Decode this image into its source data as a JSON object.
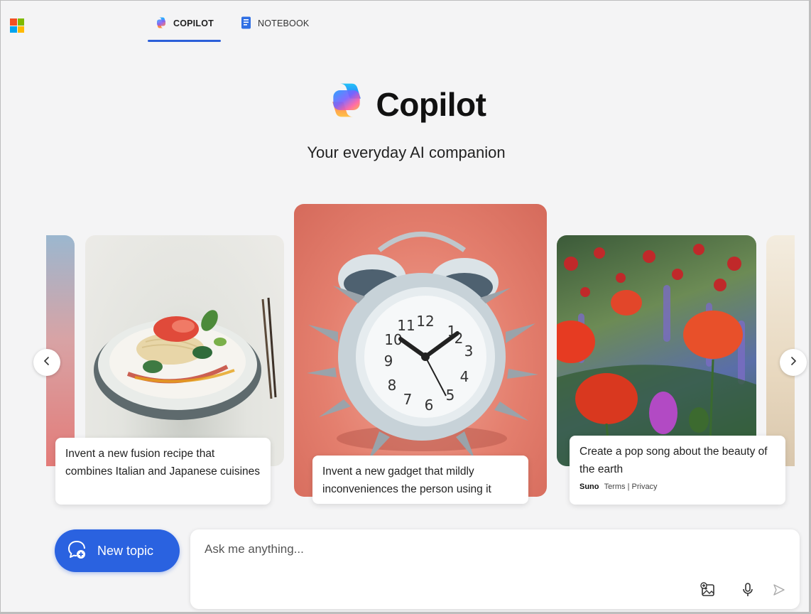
{
  "tabs": [
    {
      "label": "COPILOT"
    },
    {
      "label": "NOTEBOOK"
    }
  ],
  "hero": {
    "title": "Copilot",
    "subtitle": "Your everyday AI companion"
  },
  "cards": [
    {
      "caption": "Invent a new fusion recipe that combines Italian and Japanese cuisines"
    },
    {
      "caption": "Invent a new gadget that mildly inconveniences the person using it"
    },
    {
      "caption": "Create a pop song about the beauty of the earth",
      "brand": "Suno",
      "terms": "Terms",
      "separator": "|",
      "privacy": "Privacy"
    }
  ],
  "new_topic": {
    "label": "New topic"
  },
  "ask": {
    "placeholder": "Ask me anything..."
  },
  "icons": {
    "app_logo": "microsoft-logo-icon",
    "copilot": "copilot-logo-icon",
    "notebook": "notebook-icon",
    "prev": "chevron-left-icon",
    "next": "chevron-right-icon",
    "new_topic": "chat-add-icon",
    "image_upload": "image-add-icon",
    "mic": "microphone-icon",
    "send": "send-icon"
  },
  "colors": {
    "accent": "#2a62e0",
    "tab_underline": "#2b5fd9",
    "background": "#f4f4f5"
  }
}
